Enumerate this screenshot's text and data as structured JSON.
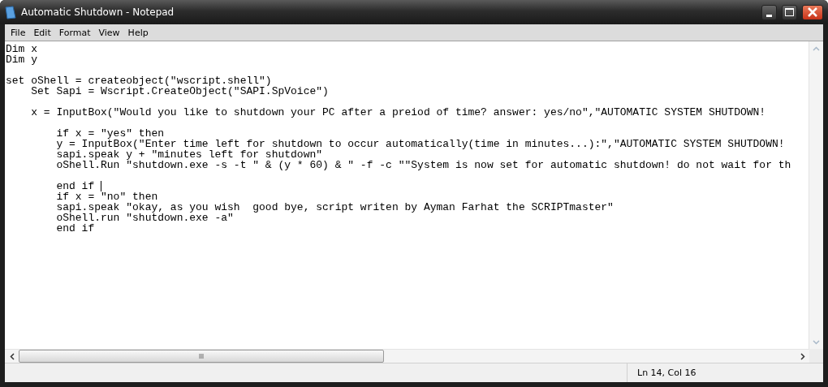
{
  "window": {
    "title": "Automatic Shutdown - Notepad"
  },
  "menu": [
    "File",
    "Edit",
    "Format",
    "View",
    "Help"
  ],
  "blocks": [
    {
      "lines": [
        {
          "text": "Dim x",
          "caret": false
        },
        {
          "text": "Dim y",
          "caret": false
        }
      ]
    },
    {
      "lines": [
        {
          "text": "set oShell = createobject(\"wscript.shell\")",
          "caret": false
        },
        {
          "text": "    Set Sapi = Wscript.CreateObject(\"SAPI.SpVoice\")",
          "caret": false
        }
      ]
    },
    {
      "lines": [
        {
          "text": "    x = InputBox(\"Would you like to shutdown your PC after a preiod of time? answer: yes/no\",\"AUTOMATIC SYSTEM SHUTDOWN!",
          "caret": false
        }
      ]
    },
    {
      "lines": [
        {
          "text": "        if x = \"yes\" then",
          "caret": false
        },
        {
          "text": "        y = InputBox(\"Enter time left for shutdown to occur automatically(time in minutes...):\",\"AUTOMATIC SYSTEM SHUTDOWN!",
          "caret": false
        },
        {
          "text": "        sapi.speak y + \"minutes left for shutdown\"",
          "caret": false
        },
        {
          "text": "        oShell.Run \"shutdown.exe -s -t \" & (y * 60) & \" -f -c \"\"System is now set for automatic shutdown! do not wait for th",
          "caret": false
        }
      ]
    },
    {
      "lines": [
        {
          "text": "        end if ",
          "caret": true
        },
        {
          "text": "        if x = \"no\" then",
          "caret": false
        },
        {
          "text": "        sapi.speak \"okay, as you wish  good bye, script writen by Ayman Farhat the SCRIPTmaster\"",
          "caret": false
        },
        {
          "text": "        oShell.run \"shutdown.exe -a\"",
          "caret": false
        },
        {
          "text": "        end if",
          "caret": false
        }
      ]
    }
  ],
  "status_bar": {
    "position": "Ln 14, Col 16"
  }
}
